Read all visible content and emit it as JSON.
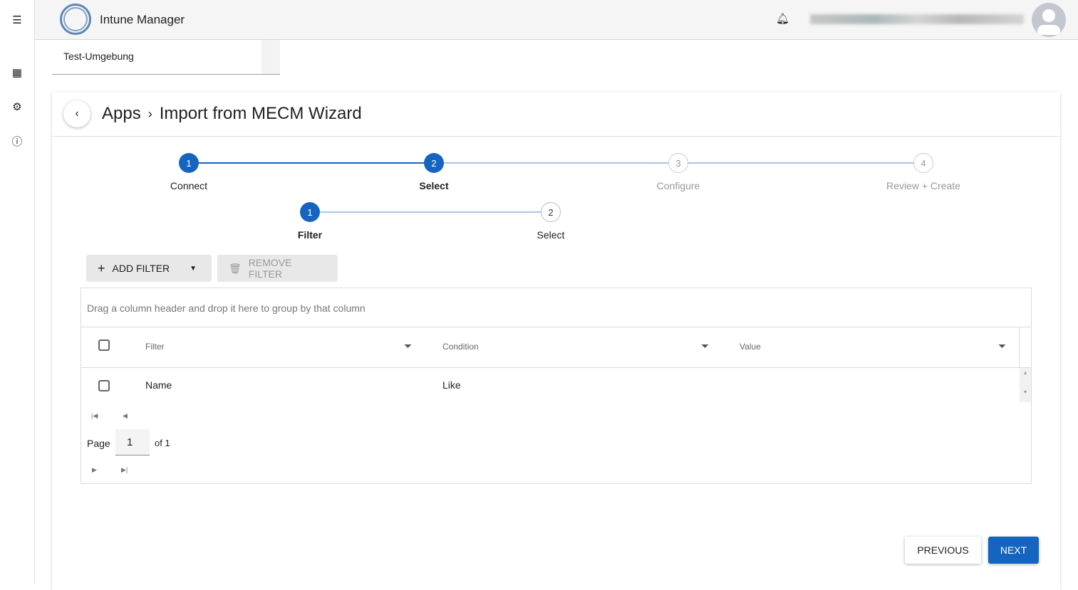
{
  "app": {
    "title": "Intune Manager",
    "environment": "Test-Umgebung"
  },
  "rail": {
    "icons": [
      "menu-icon",
      "apps-grid-icon",
      "settings-icon",
      "info-icon"
    ]
  },
  "breadcrumb": {
    "parent": "Apps",
    "separator": "›",
    "current": "Import from MECM Wizard"
  },
  "steps": [
    {
      "num": "1",
      "label": "Connect",
      "state": "done"
    },
    {
      "num": "2",
      "label": "Select",
      "state": "active"
    },
    {
      "num": "3",
      "label": "Configure",
      "state": "pending"
    },
    {
      "num": "4",
      "label": "Review + Create",
      "state": "pending"
    }
  ],
  "substeps": [
    {
      "num": "1",
      "label": "Filter",
      "state": "active"
    },
    {
      "num": "2",
      "label": "Select",
      "state": "pending"
    }
  ],
  "toolbar": {
    "add_filter": "ADD FILTER",
    "remove_filter": "REMOVE FILTER"
  },
  "grid": {
    "group_hint": "Drag a column header and drop it here to group by that column",
    "columns": [
      "Filter",
      "Condition",
      "Value"
    ],
    "rows": [
      {
        "filter": "Name",
        "condition": "Like",
        "value": ""
      }
    ]
  },
  "pager": {
    "page_label": "Page",
    "page": "1",
    "of_label": "of 1"
  },
  "footer": {
    "previous": "PREVIOUS",
    "next": "NEXT"
  },
  "colors": {
    "accent": "#1565c0"
  }
}
